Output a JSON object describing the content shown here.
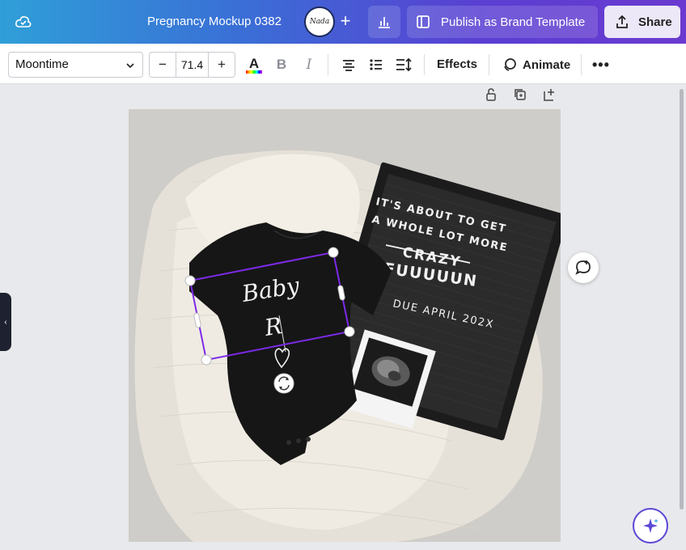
{
  "header": {
    "document_title": "Pregnancy Mockup 0382",
    "avatar_text": "Nada",
    "publish_label": "Publish as Brand Template",
    "share_label": "Share"
  },
  "toolbar": {
    "font_name": "Moontime",
    "font_size": "71.4",
    "decrease_label": "−",
    "increase_label": "+",
    "text_color_glyph": "A",
    "bold_glyph": "B",
    "italic_glyph": "I",
    "effects_label": "Effects",
    "animate_label": "Animate",
    "more_glyph": "•••"
  },
  "canvas": {
    "onesie_text_line1": "Baby",
    "onesie_text_line2": "R",
    "letterboard": {
      "line1": "IT'S ABOUT TO GET",
      "line2": "A WHOLE LOT MORE",
      "line3": "CRAZY",
      "line4": "FUUUUUN",
      "line5": "DUE APRIL 202X"
    }
  },
  "colors": {
    "accent_purple": "#7d2ae8",
    "share_bg": "#ece8f7",
    "toolbar_bg": "#ffffff"
  },
  "icons": [
    "cloud-icon",
    "plus-icon",
    "stats-icon",
    "template-icon",
    "upload-icon",
    "chevron-down-icon",
    "align-center-icon",
    "list-icon",
    "spacing-icon",
    "animate-icon",
    "lock-icon",
    "duplicate-icon",
    "add-page-icon",
    "comment-icon",
    "magic-icon",
    "rotate-icon"
  ]
}
